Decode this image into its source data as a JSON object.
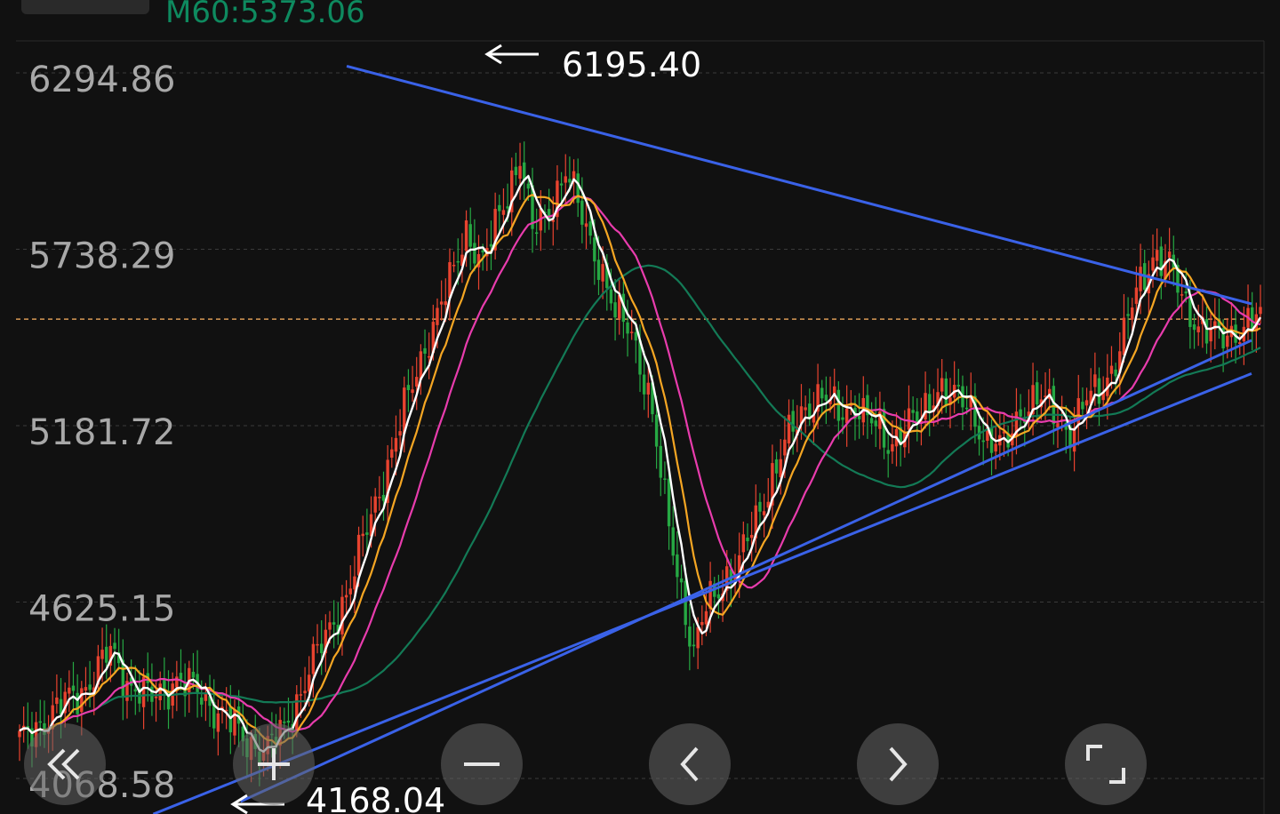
{
  "header": {
    "ma_label": "M60:5373.06"
  },
  "chart_data": {
    "type": "candlestick",
    "y_ticks": [
      "6294.86",
      "5738.29",
      "5181.72",
      "4625.15",
      "4068.58"
    ],
    "y_tick_values": [
      6294.86,
      5738.29,
      5181.72,
      4625.15,
      4068.58
    ],
    "ylim": [
      3970,
      6345
    ],
    "grid": true,
    "reference_price": 5532,
    "annotations": [
      {
        "text": "6195.40",
        "value": 6195.4,
        "arrow": "left"
      },
      {
        "text": "4168.04",
        "value": 4168.04,
        "arrow": "left"
      }
    ],
    "colors": {
      "up": "#e8432f",
      "down": "#26a843",
      "ma5": "#ffffff",
      "ma10": "#f5a623",
      "ma20": "#e83cad",
      "ma60": "#137a56",
      "trendline": "#3a62e8",
      "reference": "#d99a55"
    },
    "trendlines": [
      {
        "name": "upper",
        "from": [
          0.265,
          6330
        ],
        "to": [
          0.99,
          5580
        ]
      },
      {
        "name": "lower",
        "from": [
          0.11,
          3970
        ],
        "to": [
          0.99,
          5360
        ]
      },
      {
        "name": "lower-inner",
        "from": [
          0.18,
          4010
        ],
        "to": [
          0.99,
          5465
        ]
      }
    ]
  },
  "controls": [
    {
      "name": "rewind-button",
      "icon": "double-chevron-left-icon"
    },
    {
      "name": "zoom-in-button",
      "icon": "plus-icon"
    },
    {
      "name": "zoom-out-button",
      "icon": "minus-icon"
    },
    {
      "name": "scroll-left-button",
      "icon": "chevron-left-icon"
    },
    {
      "name": "scroll-right-button",
      "icon": "chevron-right-icon"
    },
    {
      "name": "fullscreen-button",
      "icon": "fullscreen-icon"
    }
  ]
}
